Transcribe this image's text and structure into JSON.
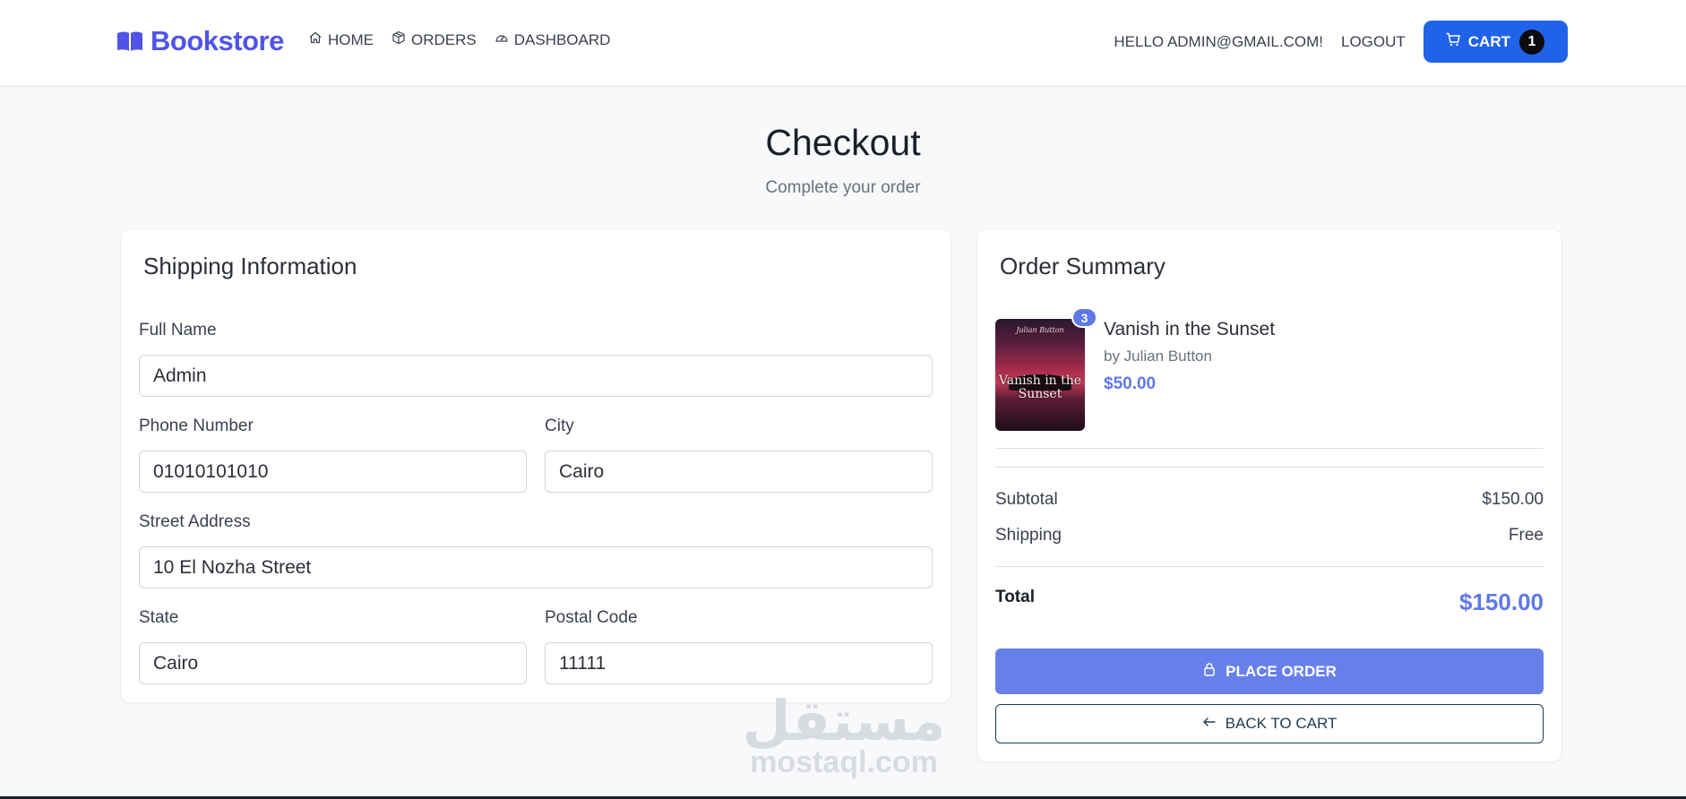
{
  "navbar": {
    "brand": "Bookstore",
    "links": [
      {
        "label": "HOME",
        "icon": "home-icon"
      },
      {
        "label": "ORDERS",
        "icon": "box-icon"
      },
      {
        "label": "DASHBOARD",
        "icon": "gauge-icon"
      }
    ],
    "greeting": "HELLO ADMIN@GMAIL.COM!",
    "logout": "LOGOUT",
    "cart_label": "CART",
    "cart_count": "1"
  },
  "header": {
    "title": "Checkout",
    "subtitle": "Complete your order"
  },
  "shipping": {
    "title": "Shipping Information",
    "full_name": {
      "label": "Full Name",
      "value": "Admin"
    },
    "phone": {
      "label": "Phone Number",
      "value": "01010101010"
    },
    "city": {
      "label": "City",
      "value": "Cairo"
    },
    "street": {
      "label": "Street Address",
      "value": "10 El Nozha Street"
    },
    "state": {
      "label": "State",
      "value": "Cairo"
    },
    "postal": {
      "label": "Postal Code",
      "value": "11111"
    }
  },
  "summary": {
    "title": "Order Summary",
    "item": {
      "quantity": "3",
      "title": "Vanish in the Sunset",
      "author": "by Julian Button",
      "price": "$50.00",
      "cover_title": "Vanish in the Sunset",
      "cover_author": "Julian Button"
    },
    "subtotal_label": "Subtotal",
    "subtotal_value": "$150.00",
    "shipping_label": "Shipping",
    "shipping_value": "Free",
    "total_label": "Total",
    "total_value": "$150.00",
    "place_order": "PLACE ORDER",
    "back_to_cart": "BACK TO CART"
  },
  "watermark": {
    "arabic": "مستقل",
    "latin": "mostaql.com"
  },
  "colors": {
    "brand": "#4f54e6",
    "cart_button": "#2163e8",
    "accent": "#5f78e8",
    "place_order_button": "#6780e9",
    "back_button_border": "#1f3b52"
  }
}
